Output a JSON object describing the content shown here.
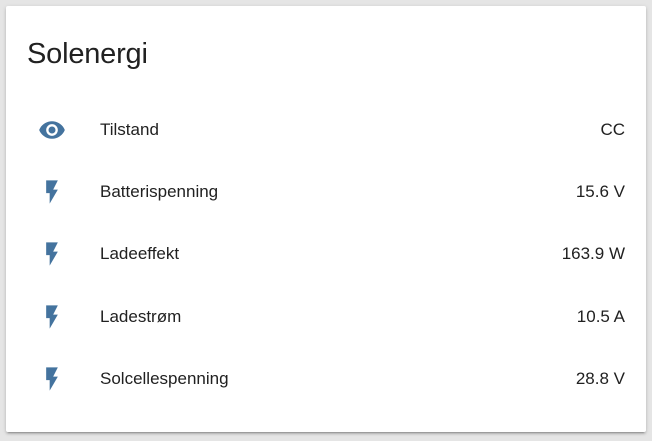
{
  "card": {
    "title": "Solenergi",
    "accent_color": "#44739e",
    "rows": [
      {
        "icon": "eye-icon",
        "name": "Tilstand",
        "state": "CC"
      },
      {
        "icon": "flash-icon",
        "name": "Batterispenning",
        "state": "15.6 V"
      },
      {
        "icon": "flash-icon",
        "name": "Ladeeffekt",
        "state": "163.9 W"
      },
      {
        "icon": "flash-icon",
        "name": "Ladestrøm",
        "state": "10.5 A"
      },
      {
        "icon": "flash-icon",
        "name": "Solcellespenning",
        "state": "28.8 V"
      }
    ]
  }
}
